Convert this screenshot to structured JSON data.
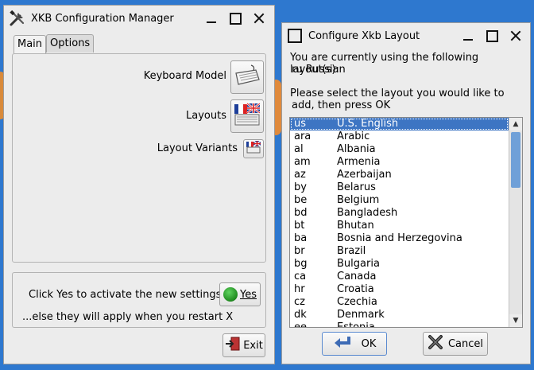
{
  "manager": {
    "title": "XKB Configuration Manager",
    "tabs": [
      {
        "label": "Main",
        "active": true
      },
      {
        "label": "Options",
        "active": false
      }
    ],
    "keyboard_model_label": "Keyboard Model",
    "layouts_label": "Layouts",
    "layout_variants_label": "Layout Variants",
    "activate_text": "Click Yes to activate the new settings",
    "yes_label": "Yes",
    "restart_text": "...else they will apply when you restart X",
    "exit_label": "Exit"
  },
  "dialog": {
    "title": "Configure Xkb Layout",
    "current_text": "You are currently using the following layout(s):",
    "current_layout": "ru Russian",
    "prompt_line1": "Please select the layout you would like to",
    "prompt_line2": "add, then press OK",
    "layouts": [
      {
        "code": "us",
        "name": "U.S. English",
        "selected": true
      },
      {
        "code": "ara",
        "name": "Arabic"
      },
      {
        "code": "al",
        "name": "Albania"
      },
      {
        "code": "am",
        "name": "Armenia"
      },
      {
        "code": "az",
        "name": "Azerbaijan"
      },
      {
        "code": "by",
        "name": "Belarus"
      },
      {
        "code": "be",
        "name": "Belgium"
      },
      {
        "code": "bd",
        "name": "Bangladesh"
      },
      {
        "code": "bt",
        "name": "Bhutan"
      },
      {
        "code": "ba",
        "name": "Bosnia and Herzegovina"
      },
      {
        "code": "br",
        "name": "Brazil"
      },
      {
        "code": "bg",
        "name": "Bulgaria"
      },
      {
        "code": "ca",
        "name": "Canada"
      },
      {
        "code": "hr",
        "name": "Croatia"
      },
      {
        "code": "cz",
        "name": "Czechia"
      },
      {
        "code": "dk",
        "name": "Denmark"
      },
      {
        "code": "ee",
        "name": "Estonia"
      }
    ],
    "ok_label": "OK",
    "cancel_label": "Cancel"
  },
  "colors": {
    "desktop": "#2e78cf",
    "selection": "#3d75c3",
    "yes_indicator": "#1f8a1f"
  }
}
